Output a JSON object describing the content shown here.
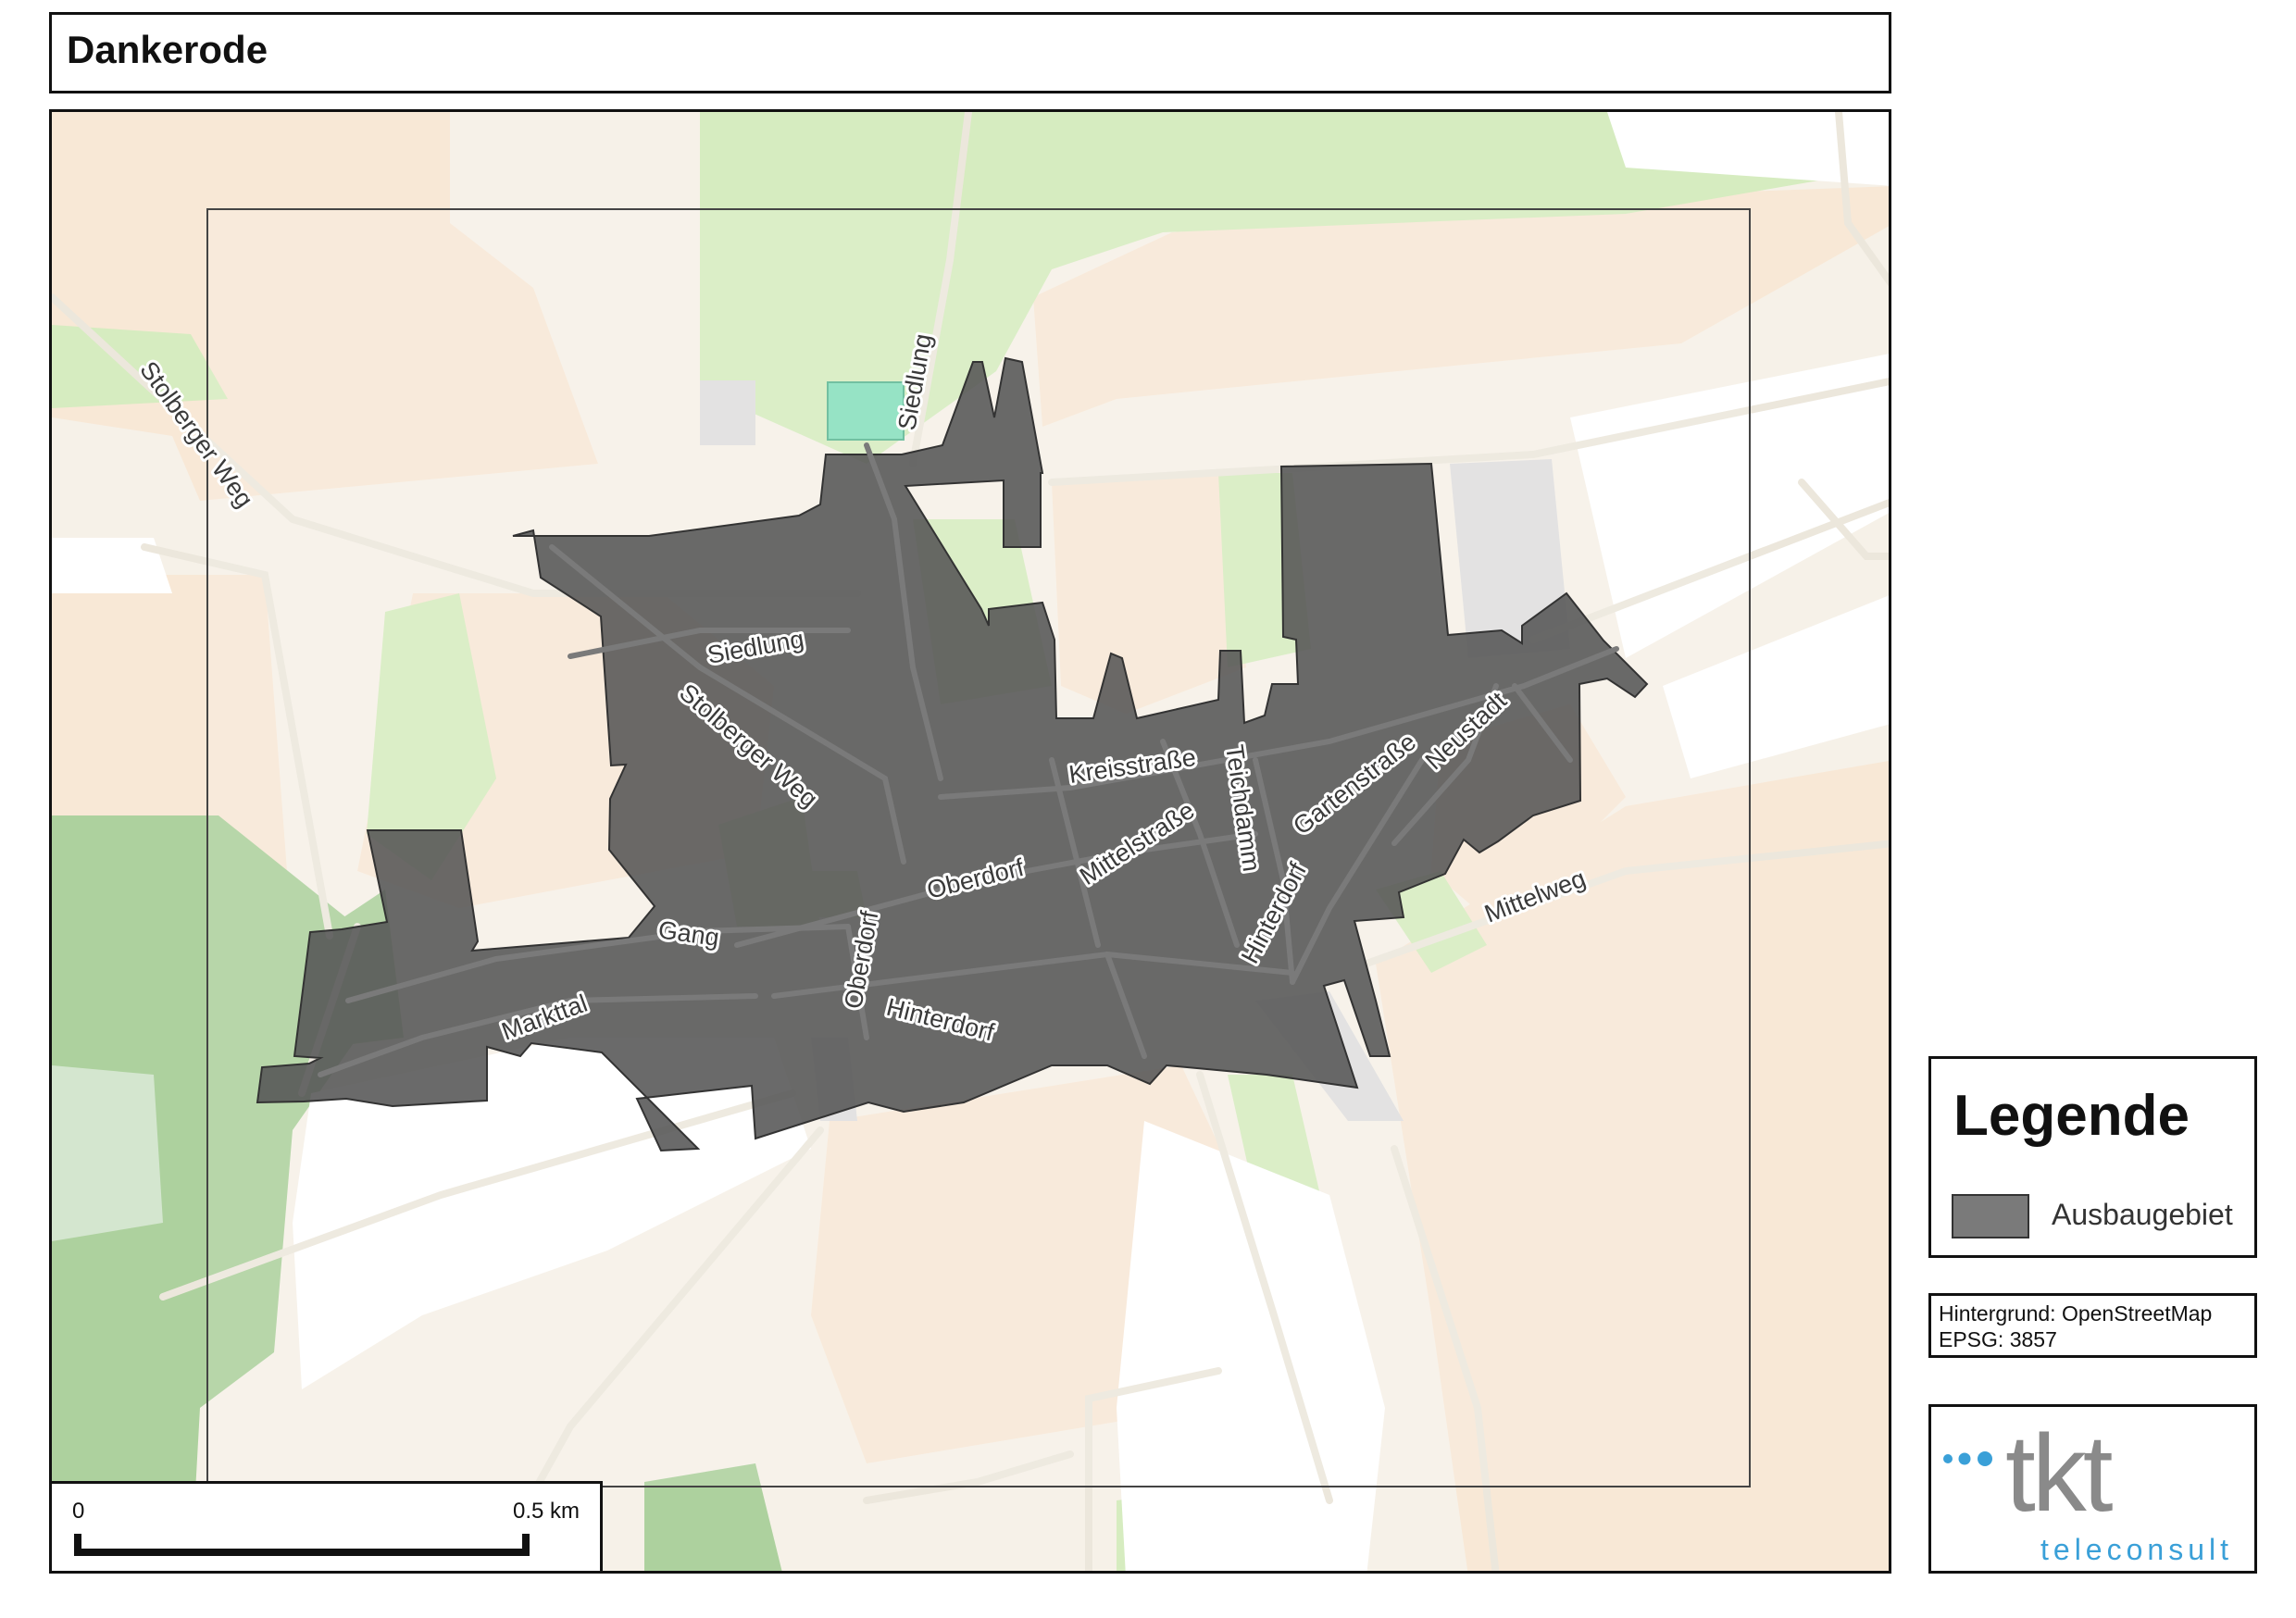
{
  "title": "Dankerode",
  "map": {
    "street_labels": [
      "Stolberger Weg",
      "Siedlung",
      "Siedlung",
      "Stolberger Weg",
      "Kreisstraße",
      "Teichdamm",
      "Gartenstraße",
      "Neustadt",
      "Mittelstraße",
      "Oberdorf",
      "Oberdorf",
      "Gang",
      "Markttal",
      "Hinterdorf",
      "Hinterdorf",
      "Mittelweg"
    ],
    "colors": {
      "farmland": "#f8e8d6",
      "meadow": "#d6ecc0",
      "forest": "#add19e",
      "residential": "#e0dfdf",
      "road": "#ece7dc",
      "ausbaugebiet": "#555555",
      "pitch": "#88e0be"
    }
  },
  "scale": {
    "start": "0",
    "end": "0.5 km"
  },
  "legend": {
    "title": "Legende",
    "items": [
      {
        "label": "Ausbaugebiet",
        "color": "#7a7a7a"
      }
    ]
  },
  "source": {
    "background": "Hintergrund: OpenStreetMap",
    "crs": "EPSG: 3857"
  },
  "logo": {
    "brand": "tkt",
    "subtitle": "teleconsult",
    "brand_color": "#8a8a8a",
    "accent_color": "#3aa0d8"
  }
}
